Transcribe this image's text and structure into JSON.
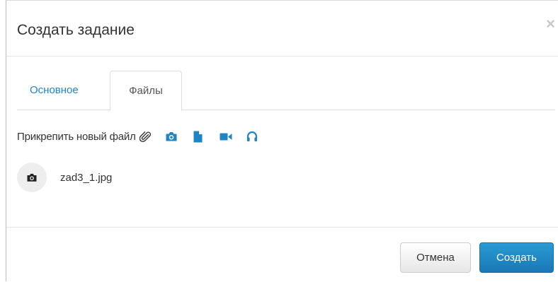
{
  "dialog": {
    "title": "Создать задание",
    "close_label": "×"
  },
  "tabs": [
    {
      "label": "Основное",
      "active": false
    },
    {
      "label": "Файлы",
      "active": true
    }
  ],
  "attach": {
    "label": "Прикрепить новый файл",
    "icons": [
      "paperclip-icon",
      "camera-icon",
      "file-icon",
      "video-icon",
      "headphones-icon"
    ]
  },
  "files": [
    {
      "name": "zad3_1.jpg",
      "icon": "camera-icon"
    }
  ],
  "footer": {
    "cancel_label": "Отмена",
    "create_label": "Создать"
  },
  "colors": {
    "accent": "#1f84c6",
    "primary_button": "#1e88c6"
  }
}
